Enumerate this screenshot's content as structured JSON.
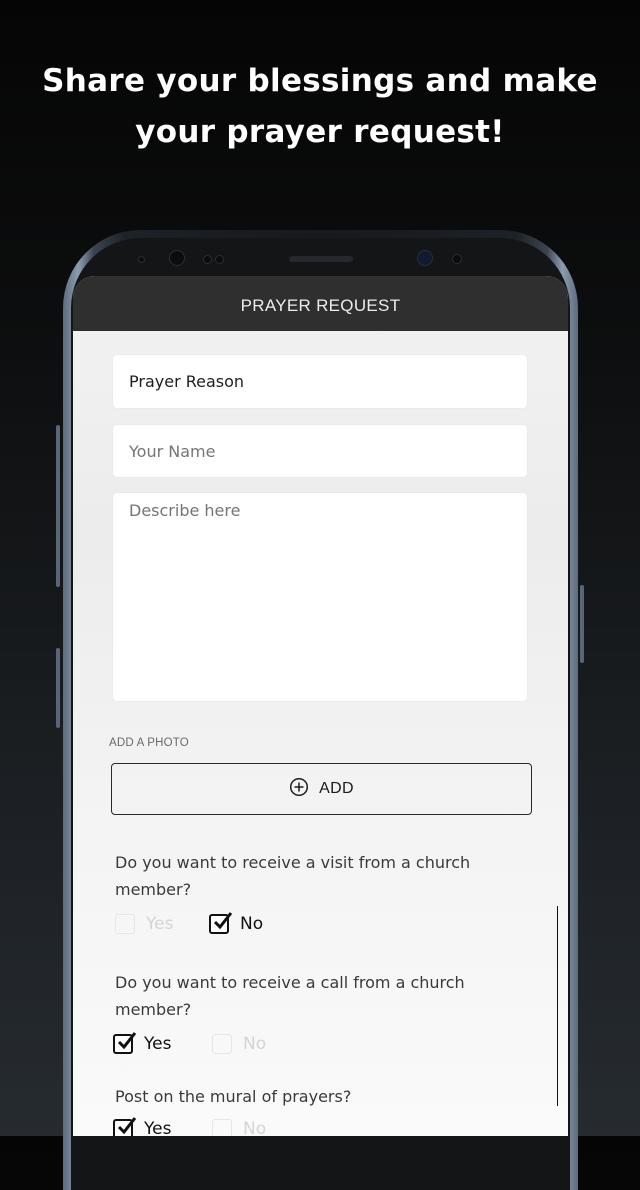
{
  "headline": {
    "line1": "Share your blessings and make",
    "line2": "your prayer request!"
  },
  "app": {
    "title": "PRAYER REQUEST"
  },
  "form": {
    "prayer_reason": {
      "value": "Prayer Reason"
    },
    "your_name": {
      "placeholder": "Your Name",
      "value": ""
    },
    "description": {
      "placeholder": "Describe here",
      "value": ""
    },
    "add_photo": {
      "label": "ADD A PHOTO",
      "button_label": "ADD",
      "icon": "plus-circle-icon"
    },
    "questions": [
      {
        "text": "Do you want to receive a visit from a church member?",
        "options": [
          {
            "label": "Yes",
            "checked": false
          },
          {
            "label": "No",
            "checked": true
          }
        ]
      },
      {
        "text": "Do you want to receive a call from a church member?",
        "options": [
          {
            "label": "Yes",
            "checked": true
          },
          {
            "label": "No",
            "checked": false
          }
        ]
      },
      {
        "text": "Post on the mural of prayers?",
        "options": [
          {
            "label": "Yes",
            "checked": true
          },
          {
            "label": "No",
            "checked": false
          }
        ]
      }
    ]
  },
  "colors": {
    "appbar": "#2f2f2f",
    "text_dark": "#111111",
    "placeholder": "#bdbdbd"
  }
}
